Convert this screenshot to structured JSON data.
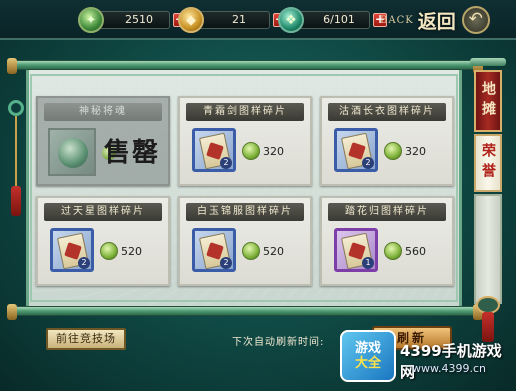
{
  "resources": [
    {
      "value": "2510",
      "icon": "jade-coin-icon"
    },
    {
      "value": "21",
      "icon": "gold-ingot-icon"
    },
    {
      "value": "6/101",
      "icon": "jade-gem-icon"
    }
  ],
  "back": {
    "en": "BACK",
    "zh": "返回",
    "icon": "return-arrow-icon"
  },
  "side_tabs": [
    "地摊",
    "荣誉"
  ],
  "cards": [
    {
      "title": "神秘将魂",
      "sold": true,
      "sold_label": "售罄",
      "price": ""
    },
    {
      "title": "青霜剑图样碎片",
      "sold": false,
      "price": "320",
      "qty": "2",
      "rarity": "blue"
    },
    {
      "title": "沽酒长衣图样碎片",
      "sold": false,
      "price": "320",
      "qty": "2",
      "rarity": "blue"
    },
    {
      "title": "过天星图样碎片",
      "sold": false,
      "price": "520",
      "qty": "2",
      "rarity": "blue"
    },
    {
      "title": "白玉锦服图样碎片",
      "sold": false,
      "price": "520",
      "qty": "2",
      "rarity": "blue"
    },
    {
      "title": "踏花归图样碎片",
      "sold": false,
      "price": "560",
      "qty": "1",
      "rarity": "purple"
    }
  ],
  "bottom": {
    "arena_button": "前往竞技场",
    "refresh_text": "下次自动刷新时间:",
    "refresh_button": "刷新"
  },
  "watermark": {
    "logo_line1": "游戏",
    "logo_line2": "大全",
    "text": "4399手机游戏网",
    "url": "www.4399.cn"
  },
  "colors": {
    "accent_red": "#a62a22",
    "frame_teal": "#1c6a63",
    "coin_green": "#7eb23a",
    "blue_rarity": "#3b5da8",
    "purple_rarity": "#7d3ea8"
  }
}
